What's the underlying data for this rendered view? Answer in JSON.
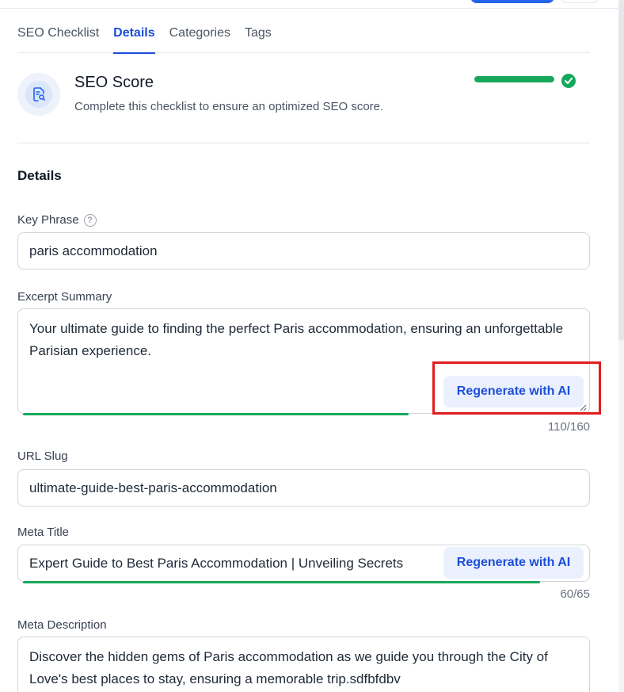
{
  "tabs": [
    {
      "label": "SEO Checklist",
      "active": false
    },
    {
      "label": "Details",
      "active": true
    },
    {
      "label": "Categories",
      "active": false
    },
    {
      "label": "Tags",
      "active": false
    }
  ],
  "seo_score": {
    "title": "SEO Score",
    "subtitle": "Complete this checklist to ensure an optimized SEO score.",
    "progress_percent": 100,
    "status_icon": "check-circle-icon",
    "color": "#17a85b"
  },
  "details": {
    "section_title": "Details",
    "key_phrase": {
      "label": "Key Phrase",
      "value": "paris accommodation",
      "help_icon": "question-circle-icon"
    },
    "excerpt": {
      "label": "Excerpt Summary",
      "value": "Your ultimate guide to finding the perfect Paris accommodation, ensuring an unforgettable Parisian experience.",
      "button_label": "Regenerate with AI",
      "counter": "110/160",
      "progress_fraction": 0.6875
    },
    "url_slug": {
      "label": "URL Slug",
      "value": "ultimate-guide-best-paris-accommodation"
    },
    "meta_title": {
      "label": "Meta Title",
      "value": "Expert Guide to Best Paris Accommodation | Unveiling Secrets",
      "button_label": "Regenerate with AI",
      "counter": "60/65",
      "progress_fraction": 0.923
    },
    "meta_description": {
      "label": "Meta Description",
      "value": "Discover the hidden gems of Paris accommodation as we guide you through the City of Love's best places to stay, ensuring a memorable trip.sdfbfdbv"
    }
  },
  "colors": {
    "accent": "#1d4ed8",
    "success": "#17a85b",
    "highlight": "#e11d1d"
  }
}
